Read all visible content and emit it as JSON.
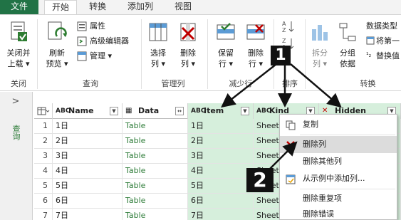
{
  "ribbon_tabs": [
    "文件",
    "开始",
    "转换",
    "添加列",
    "视图"
  ],
  "ribbon": {
    "close_load": [
      "关闭并",
      "上载"
    ],
    "refresh_preview": [
      "刷新",
      "预览"
    ],
    "properties": "属性",
    "advanced_editor": "高级编辑器",
    "manage": "管理",
    "choose_columns": [
      "选择",
      "列"
    ],
    "remove_columns": [
      "删除",
      "列"
    ],
    "keep_rows": [
      "保留",
      "行"
    ],
    "remove_rows": [
      "删除",
      "行"
    ],
    "split_column": [
      "拆分",
      "列"
    ],
    "group_by": [
      "分组",
      "依据"
    ],
    "data_type": "数据类型",
    "use_first_row": "将第一",
    "replace_values": "替换值",
    "groups": [
      "关闭",
      "查询",
      "管理列",
      "减少行",
      "排序",
      "转换"
    ]
  },
  "side_pane_label": "查询",
  "columns": [
    {
      "type_glyph": "ABC",
      "label": "Name"
    },
    {
      "type_glyph": "▦",
      "label": "Data"
    },
    {
      "type_glyph": "ABC",
      "label": "Item"
    },
    {
      "type_glyph": "ABC",
      "label": "Kind"
    },
    {
      "type_glyph": "✕",
      "label": "Hidden"
    }
  ],
  "rows": [
    {
      "num": "1",
      "name": "1日",
      "data": "Table",
      "item": "1日",
      "kind": "Sheet"
    },
    {
      "num": "2",
      "name": "2日",
      "data": "Table",
      "item": "2日",
      "kind": "Sheet"
    },
    {
      "num": "3",
      "name": "3日",
      "data": "Table",
      "item": "3日",
      "kind": "Sheet"
    },
    {
      "num": "4",
      "name": "4日",
      "data": "Table",
      "item": "4日",
      "kind": "Sheet"
    },
    {
      "num": "5",
      "name": "5日",
      "data": "Table",
      "item": "5日",
      "kind": "Sheet"
    },
    {
      "num": "6",
      "name": "6日",
      "data": "Table",
      "item": "6日",
      "kind": "Sheet"
    },
    {
      "num": "7",
      "name": "7日",
      "data": "Table",
      "item": "7日",
      "kind": "Sheet"
    }
  ],
  "context_menu": {
    "copy": "复制",
    "remove_column": "删除列",
    "remove_other_columns": "删除其他列",
    "add_column_from_examples": "从示例中添加列...",
    "remove_duplicates": "删除重复项",
    "remove_errors": "删除错误"
  },
  "annotations": [
    "1",
    "2"
  ],
  "colors": {
    "file_tab": "#217346",
    "selected_column": "#d6efdc",
    "table_link": "#2f7d3a",
    "badge": "#111111"
  }
}
